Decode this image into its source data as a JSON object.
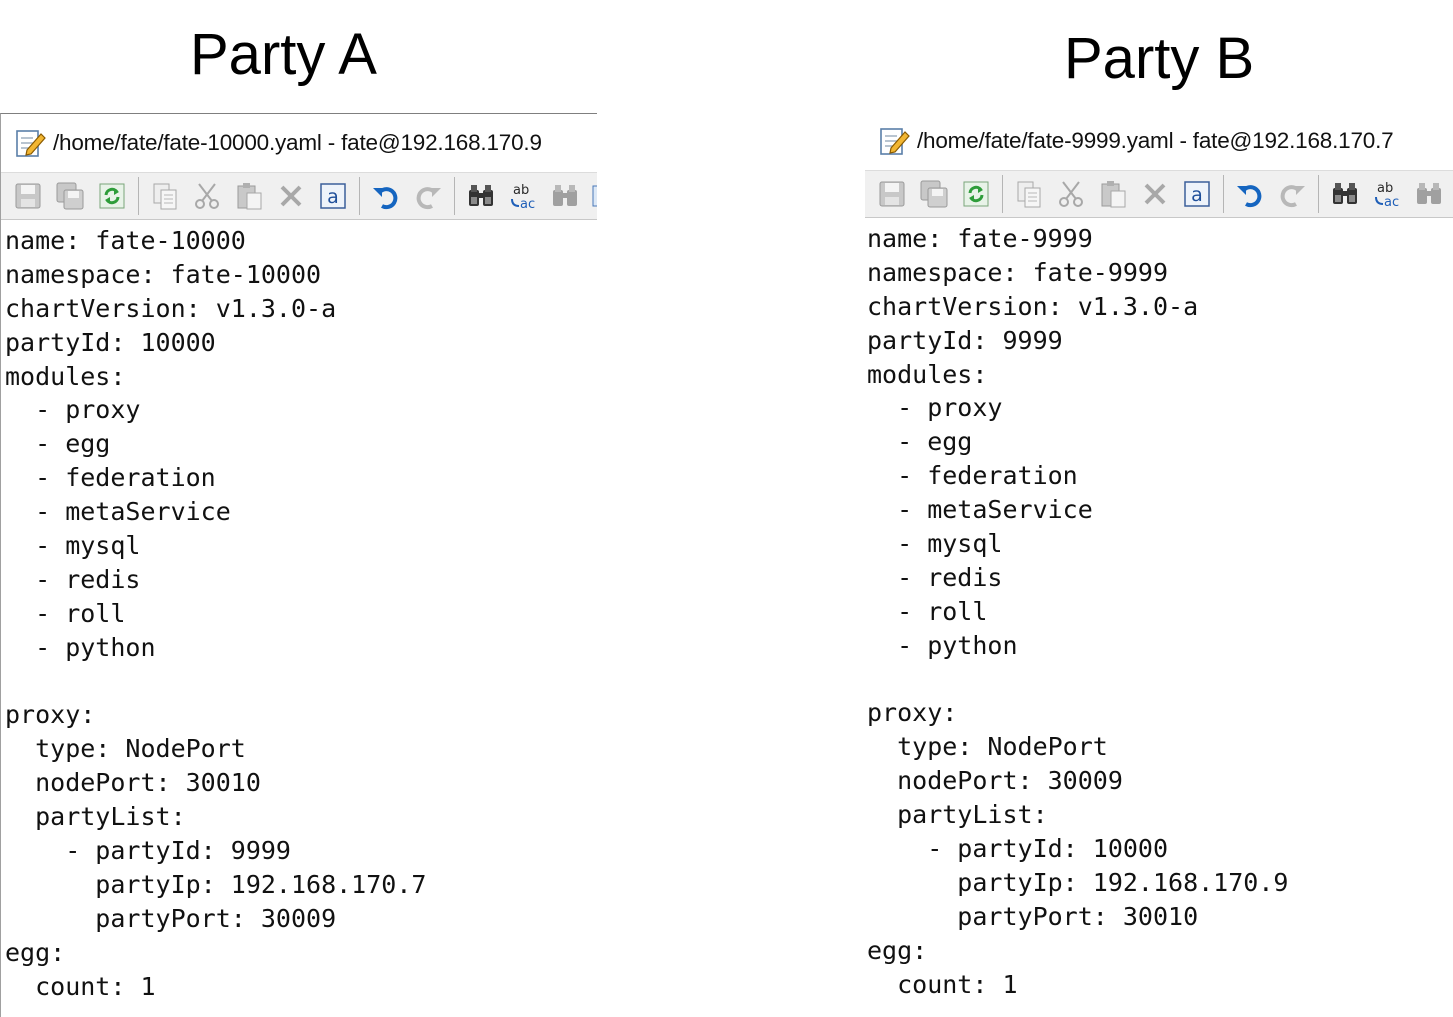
{
  "party_a": {
    "heading": "Party A",
    "window_title": "/home/fate/fate-10000.yaml - fate@192.168.170.9",
    "lines": [
      "name: fate-10000",
      "namespace: fate-10000",
      "chartVersion: v1.3.0-a",
      "partyId: 10000",
      "modules:",
      "  - proxy",
      "  - egg",
      "  - federation",
      "  - metaService",
      "  - mysql",
      "  - redis",
      "  - roll",
      "  - python",
      "",
      "proxy:",
      "  type: NodePort",
      "  nodePort: 30010",
      "  partyList:",
      "    - partyId: 9999",
      "      partyIp: 192.168.170.7",
      "      partyPort: 30009",
      "egg:",
      "  count: 1"
    ]
  },
  "party_b": {
    "heading": "Party B",
    "window_title": "/home/fate/fate-9999.yaml - fate@192.168.170.7",
    "lines": [
      "name: fate-9999",
      "namespace: fate-9999",
      "chartVersion: v1.3.0-a",
      "partyId: 9999",
      "modules:",
      "  - proxy",
      "  - egg",
      "  - federation",
      "  - metaService",
      "  - mysql",
      "  - redis",
      "  - roll",
      "  - python",
      "",
      "proxy:",
      "  type: NodePort",
      "  nodePort: 30009",
      "  partyList:",
      "    - partyId: 10000",
      "      partyIp: 192.168.170.9",
      "      partyPort: 30010",
      "egg:",
      "  count: 1"
    ]
  },
  "toolbar_icons": [
    "save-icon",
    "save-all-icon",
    "reload-icon",
    "copy-icon",
    "cut-icon",
    "paste-icon",
    "delete-icon",
    "select-all-icon",
    "undo-icon",
    "redo-icon",
    "find-icon",
    "replace-icon",
    "find-next-icon",
    "more-icon"
  ],
  "colors": {
    "toolbar_bg": "#f0f0f0",
    "undo_blue": "#1565c0",
    "reload_green": "#2e9d3a",
    "disabled_gray": "#a8a8a8"
  }
}
